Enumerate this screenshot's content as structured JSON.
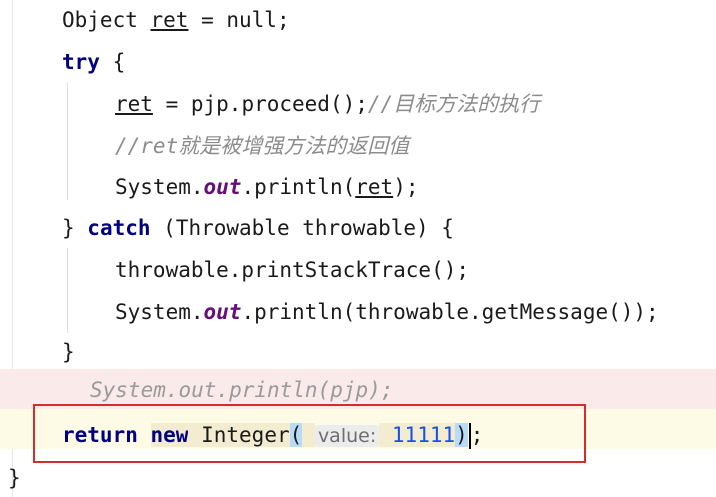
{
  "code": {
    "line1": {
      "type": "Object ",
      "var": "ret",
      "rest": " = null;"
    },
    "line2": {
      "kw": "try",
      "rest": " {"
    },
    "line3": {
      "var": "ret",
      "mid": " = pjp.proceed();",
      "comment": "//目标方法的执行"
    },
    "line4": {
      "comment": "//ret就是被增强方法的返回值"
    },
    "line5": {
      "pre": "System.",
      "field": "out",
      "mid": ".println(",
      "var": "ret",
      "post": ");"
    },
    "line6": {
      "pre": "} ",
      "kw": "catch",
      "rest": " (Throwable throwable) {"
    },
    "line7": {
      "text": "throwable.printStackTrace();"
    },
    "line8": {
      "pre": "System.",
      "field": "out",
      "post": ".println(throwable.getMessage());"
    },
    "line9": {
      "text": "}"
    },
    "line10": {
      "commented": "System.out.println(pjp);"
    },
    "line11": {
      "kw1": "return",
      "kw2": "new",
      "cls": "Integer",
      "open": "(",
      "hint": "value:",
      "num": "11111",
      "close": ")",
      "end": ";"
    },
    "line12": {
      "text": "}"
    }
  },
  "colors": {
    "keyword": "#000080",
    "field": "#660e7a",
    "comment": "#8c8c8c",
    "number": "#1750eb",
    "highlight_box": "#d92b2b"
  }
}
